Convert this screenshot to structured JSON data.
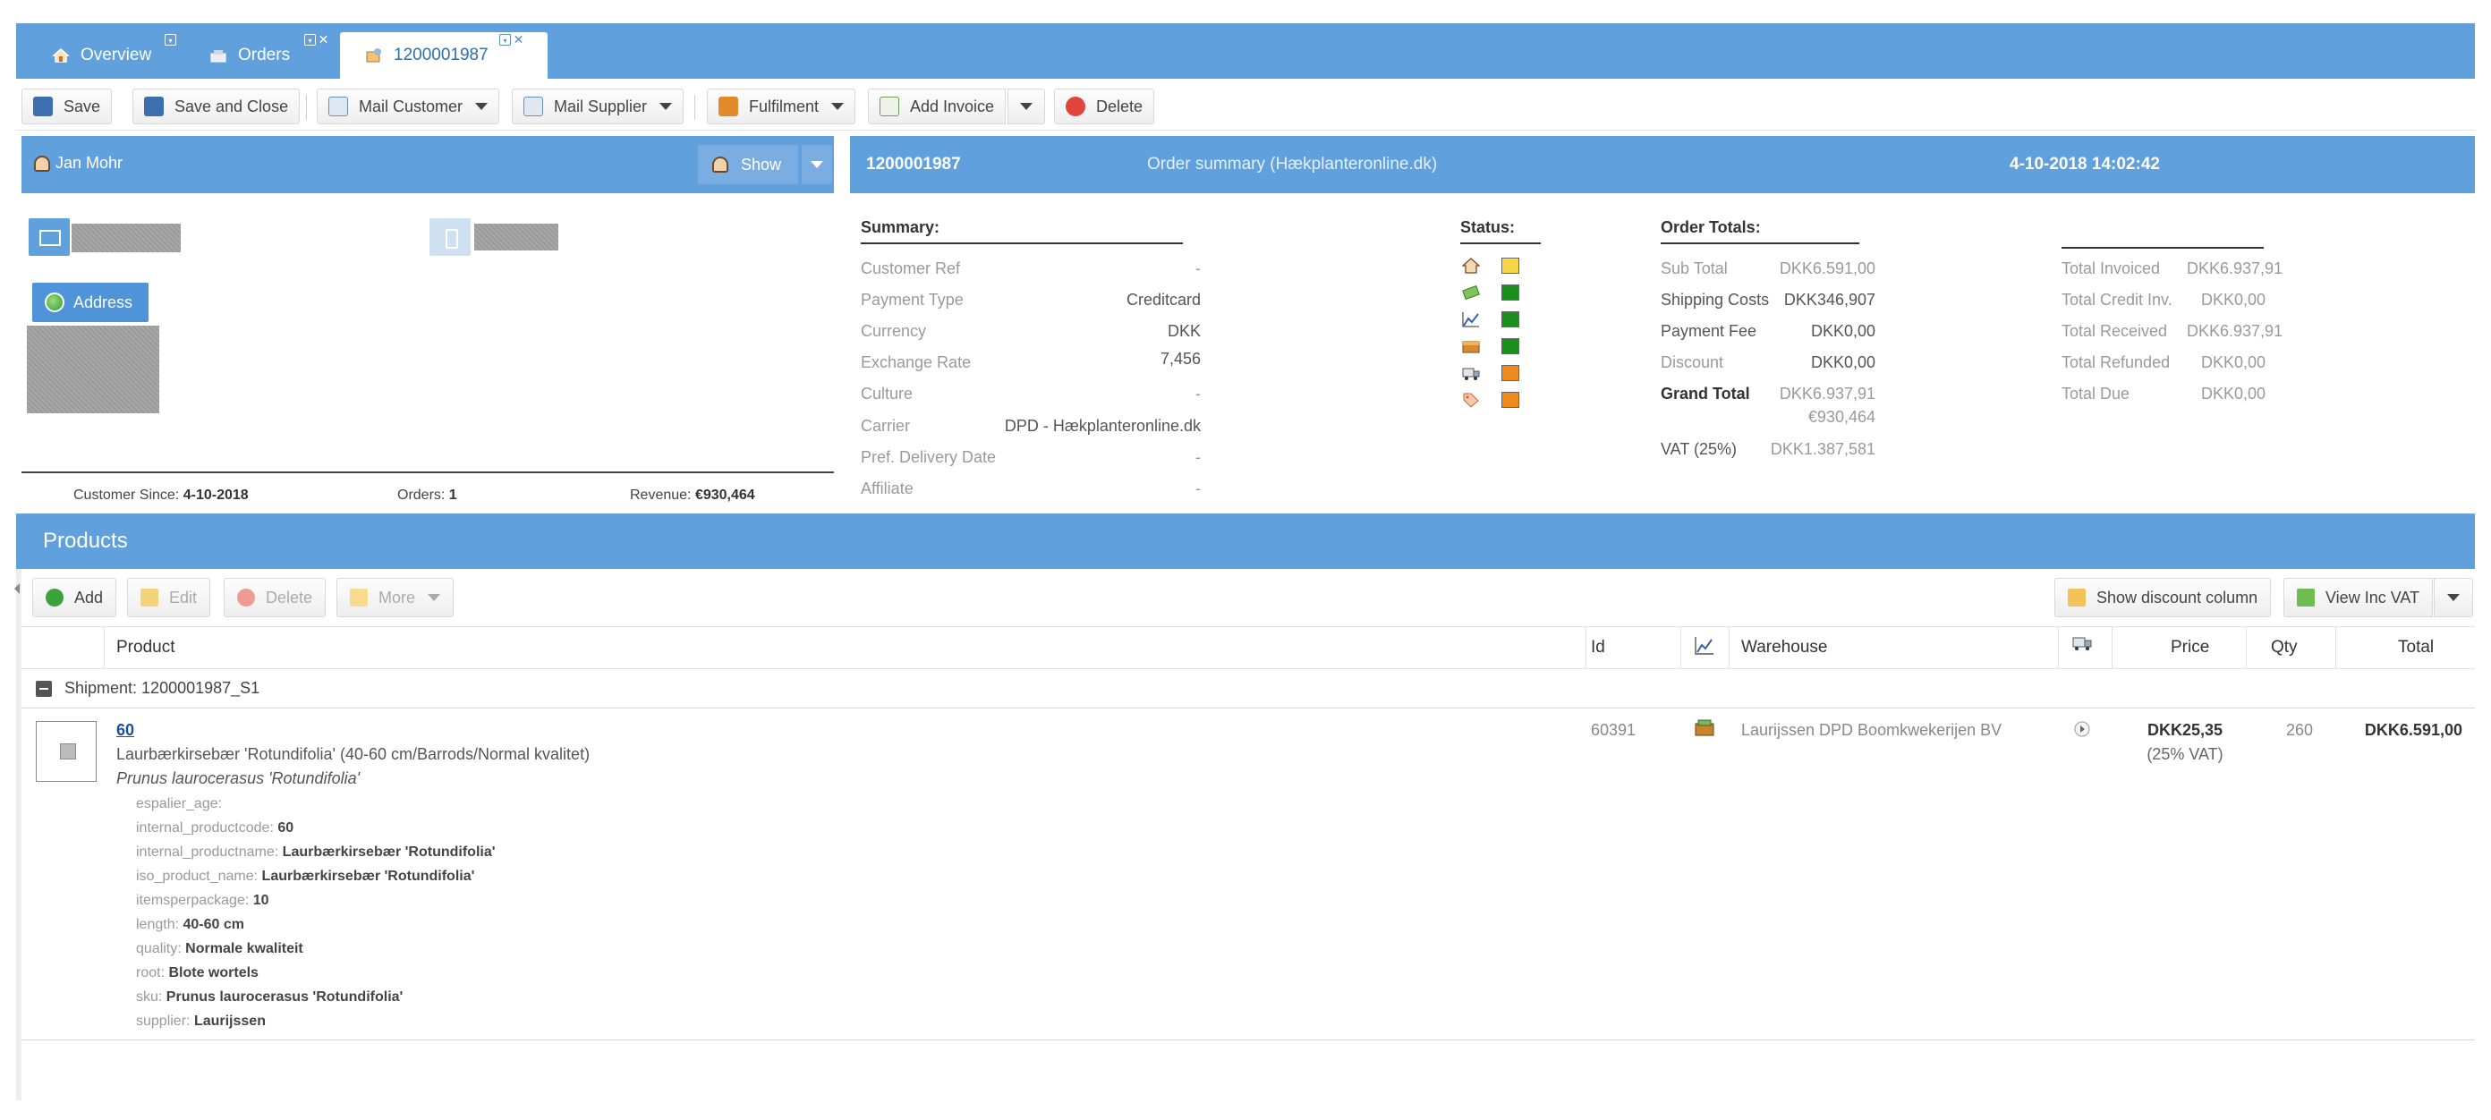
{
  "tabs": [
    {
      "label": "Overview",
      "icon": "home-icon"
    },
    {
      "label": "Orders",
      "icon": "orders-icon"
    },
    {
      "label": "1200001987",
      "icon": "order-detail-icon",
      "active": true
    }
  ],
  "toolbar": {
    "save": "Save",
    "save_close": "Save and Close",
    "mail_customer": "Mail Customer",
    "mail_supplier": "Mail Supplier",
    "fulfilment": "Fulfilment",
    "add_invoice": "Add Invoice",
    "delete": "Delete"
  },
  "customer": {
    "name": "Jan Mohr",
    "show_label": "Show",
    "address_label": "Address",
    "since_label": "Customer Since:",
    "since_value": "4-10-2018",
    "orders_label": "Orders:",
    "orders_value": "1",
    "revenue_label": "Revenue:",
    "revenue_value": "€930,464"
  },
  "order": {
    "number": "1200001987",
    "title": "Order summary (Hækplanteronline.dk)",
    "datetime": "4-10-2018 14:02:42"
  },
  "summary": {
    "title": "Summary:",
    "rows": [
      {
        "label": "Customer Ref",
        "value": "-"
      },
      {
        "label": "Payment Type",
        "value": "Creditcard"
      },
      {
        "label": "Currency",
        "value": "DKK"
      },
      {
        "label": "Exchange Rate",
        "value": "7,456"
      },
      {
        "label": "Culture",
        "value": "-"
      },
      {
        "label": "Carrier",
        "value": "DPD - Hækplanteronline.dk"
      },
      {
        "label": "Pref. Delivery Date",
        "value": "-"
      },
      {
        "label": "Affiliate",
        "value": "-"
      }
    ]
  },
  "status": {
    "title": "Status:",
    "items": [
      {
        "icon": "home-icon",
        "color": "#f6d54a"
      },
      {
        "icon": "payment-icon",
        "color": "#1b8f1b"
      },
      {
        "icon": "chart-icon",
        "color": "#1b8f1b"
      },
      {
        "icon": "box-icon",
        "color": "#1b8f1b"
      },
      {
        "icon": "truck-icon",
        "color": "#f08a1c"
      },
      {
        "icon": "tag-icon",
        "color": "#f08a1c"
      }
    ]
  },
  "totals": {
    "title": "Order Totals:",
    "sub_total_label": "Sub Total",
    "sub_total": "DKK6.591,00",
    "shipping_label": "Shipping Costs",
    "shipping": "DKK346,907",
    "payment_fee_label": "Payment Fee",
    "payment_fee": "DKK0,00",
    "discount_label": "Discount",
    "discount": "DKK0,00",
    "grand_total_label": "Grand Total",
    "grand_total": "DKK6.937,91",
    "grand_total_eur": "€930,464",
    "vat_label": "VAT (25%)",
    "vat": "DKK1.387,581"
  },
  "invoiced": {
    "total_invoiced_label": "Total Invoiced",
    "total_invoiced": "DKK6.937,91",
    "total_credit_label": "Total Credit Inv.",
    "total_credit": "DKK0,00",
    "total_received_label": "Total Received",
    "total_received": "DKK6.937,91",
    "total_refunded_label": "Total Refunded",
    "total_refunded": "DKK0,00",
    "total_due_label": "Total Due",
    "total_due": "DKK0,00"
  },
  "products": {
    "title": "Products",
    "add": "Add",
    "edit": "Edit",
    "delete": "Delete",
    "more": "More",
    "show_discount": "Show discount column",
    "view_inc_vat": "View Inc VAT",
    "columns": {
      "product": "Product",
      "id": "Id",
      "warehouse": "Warehouse",
      "price": "Price",
      "qty": "Qty",
      "total": "Total"
    },
    "shipment": "Shipment: 1200001987_S1",
    "item": {
      "code": "60",
      "name": "Laurbærkirsebær 'Rotundifolia' (40-60 cm/Barrods/Normal kvalitet)",
      "latin": "Prunus laurocerasus 'Rotundifolia'",
      "id": "60391",
      "warehouse": "Laurijssen DPD Boomkwekerijen BV",
      "price": "DKK25,35",
      "price_vat": "(25% VAT)",
      "qty": "260",
      "total": "DKK6.591,00",
      "attributes": [
        {
          "key": "espalier_age:",
          "value": ""
        },
        {
          "key": "internal_productcode:",
          "value": "60"
        },
        {
          "key": "internal_productname:",
          "value": "Laurbærkirsebær 'Rotundifolia'"
        },
        {
          "key": "iso_product_name:",
          "value": "Laurbærkirsebær 'Rotundifolia'"
        },
        {
          "key": "itemsperpackage:",
          "value": "10"
        },
        {
          "key": "length:",
          "value": "40-60 cm"
        },
        {
          "key": "quality:",
          "value": "Normale kwaliteit"
        },
        {
          "key": "root:",
          "value": "Blote wortels"
        },
        {
          "key": "sku:",
          "value": "Prunus laurocerasus 'Rotundifolia'"
        },
        {
          "key": "supplier:",
          "value": "Laurijssen"
        }
      ]
    }
  }
}
